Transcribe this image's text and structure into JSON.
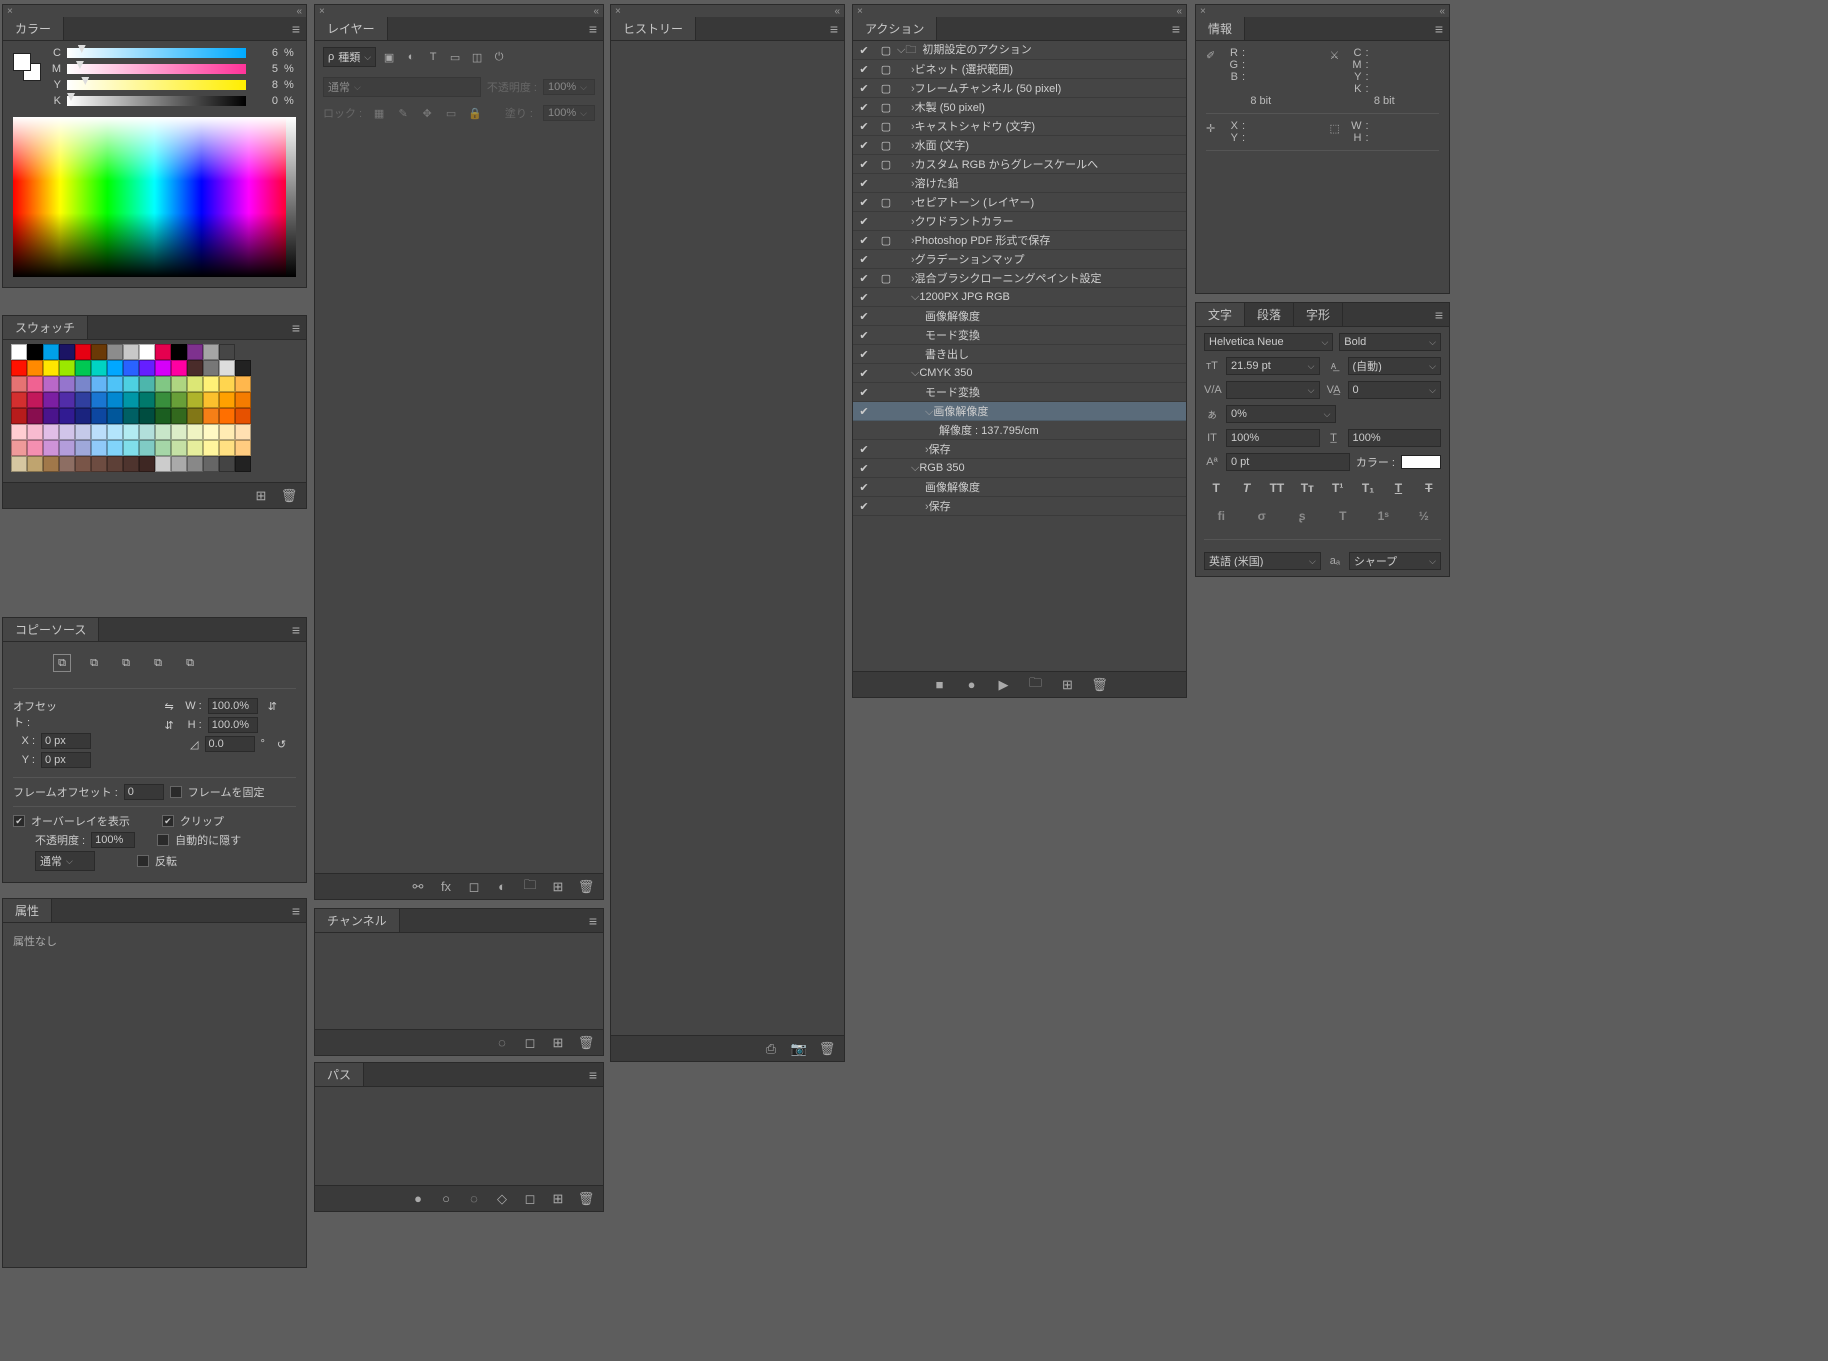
{
  "colorPanel": {
    "tab": "カラー",
    "channels": [
      {
        "label": "C",
        "value": "6",
        "pct": "%",
        "gradient": "linear-gradient(to right,#fff,#00aaff)",
        "pos": 6
      },
      {
        "label": "M",
        "value": "5",
        "pct": "%",
        "gradient": "linear-gradient(to right,#fff,#ff3399)",
        "pos": 5
      },
      {
        "label": "Y",
        "value": "8",
        "pct": "%",
        "gradient": "linear-gradient(to right,#fff,#ffee00)",
        "pos": 8
      },
      {
        "label": "K",
        "value": "0",
        "pct": "%",
        "gradient": "linear-gradient(to right,#fff,#000)",
        "pos": 0
      }
    ]
  },
  "swatchesPanel": {
    "tab": "スウォッチ"
  },
  "copySourcePanel": {
    "tab": "コピーソース",
    "offsetLabel": "オフセット :",
    "xLabel": "X :",
    "yLabel": "Y :",
    "wLabel": "W :",
    "hLabel": "H :",
    "xVal": "0 px",
    "yVal": "0 px",
    "wVal": "100.0%",
    "hVal": "100.0%",
    "angleVal": "0.0",
    "angleSuffix": "°",
    "frameOffsetLabel": "フレームオフセット :",
    "frameOffsetVal": "0",
    "lockFrameLabel": "フレームを固定",
    "showOverlayLabel": "オーバーレイを表示",
    "clipLabel": "クリップ",
    "opacityLabel": "不透明度 :",
    "opacityVal": "100%",
    "autoHideLabel": "自動的に隠す",
    "blendVal": "通常",
    "invertLabel": "反転"
  },
  "propertiesPanel": {
    "tab": "属性",
    "noProps": "属性なし"
  },
  "layersPanel": {
    "tab": "レイヤー",
    "searchPlaceholder": "種類",
    "blendVal": "通常",
    "opacityLabel": "不透明度 :",
    "opacityVal": "100%",
    "lockLabel": "ロック :",
    "fillLabel": "塗り :",
    "fillVal": "100%"
  },
  "channelsPanel": {
    "tab": "チャンネル"
  },
  "pathsPanel": {
    "tab": "パス"
  },
  "historyPanel": {
    "tab": "ヒストリー"
  },
  "actionsPanel": {
    "tab": "アクション",
    "rows": [
      {
        "check": "✔",
        "dlg": "▢",
        "exp": "⌵",
        "indent": 0,
        "folder": true,
        "label": "初期設定のアクション"
      },
      {
        "check": "✔",
        "dlg": "▢",
        "exp": "›",
        "indent": 1,
        "label": "ビネット (選択範囲)"
      },
      {
        "check": "✔",
        "dlg": "▢",
        "exp": "›",
        "indent": 1,
        "label": "フレームチャンネル (50 pixel)"
      },
      {
        "check": "✔",
        "dlg": "▢",
        "exp": "›",
        "indent": 1,
        "label": "木製 (50 pixel)"
      },
      {
        "check": "✔",
        "dlg": "▢",
        "exp": "›",
        "indent": 1,
        "label": "キャストシャドウ (文字)"
      },
      {
        "check": "✔",
        "dlg": "▢",
        "exp": "›",
        "indent": 1,
        "label": "水面 (文字)"
      },
      {
        "check": "✔",
        "dlg": "▢",
        "exp": "›",
        "indent": 1,
        "label": "カスタム RGB からグレースケールへ"
      },
      {
        "check": "✔",
        "dlg": "",
        "exp": "›",
        "indent": 1,
        "label": "溶けた鉛"
      },
      {
        "check": "✔",
        "dlg": "▢",
        "exp": "›",
        "indent": 1,
        "label": "セピアトーン (レイヤー)"
      },
      {
        "check": "✔",
        "dlg": "",
        "exp": "›",
        "indent": 1,
        "label": "クワドラントカラー"
      },
      {
        "check": "✔",
        "dlg": "▢",
        "exp": "›",
        "indent": 1,
        "label": "Photoshop PDF 形式で保存"
      },
      {
        "check": "✔",
        "dlg": "",
        "exp": "›",
        "indent": 1,
        "label": "グラデーションマップ"
      },
      {
        "check": "✔",
        "dlg": "▢",
        "exp": "›",
        "indent": 1,
        "label": "混合ブラシクローニングペイント設定"
      },
      {
        "check": "✔",
        "dlg": "",
        "exp": "⌵",
        "indent": 1,
        "label": "1200PX JPG RGB"
      },
      {
        "check": "✔",
        "dlg": "",
        "exp": "",
        "indent": 2,
        "label": "画像解像度"
      },
      {
        "check": "✔",
        "dlg": "",
        "exp": "",
        "indent": 2,
        "label": "モード変換"
      },
      {
        "check": "✔",
        "dlg": "",
        "exp": "",
        "indent": 2,
        "label": "書き出し"
      },
      {
        "check": "✔",
        "dlg": "",
        "exp": "⌵",
        "indent": 1,
        "label": "CMYK 350"
      },
      {
        "check": "✔",
        "dlg": "",
        "exp": "",
        "indent": 2,
        "label": "モード変換"
      },
      {
        "check": "✔",
        "dlg": "",
        "exp": "⌵",
        "indent": 2,
        "label": "画像解像度",
        "selected": true
      },
      {
        "check": "",
        "dlg": "",
        "exp": "",
        "indent": 3,
        "label": "解像度 : 137.795/cm"
      },
      {
        "check": "✔",
        "dlg": "",
        "exp": "›",
        "indent": 2,
        "label": "保存"
      },
      {
        "check": "✔",
        "dlg": "",
        "exp": "⌵",
        "indent": 1,
        "label": "RGB 350"
      },
      {
        "check": "✔",
        "dlg": "",
        "exp": "",
        "indent": 2,
        "label": "画像解像度"
      },
      {
        "check": "✔",
        "dlg": "",
        "exp": "›",
        "indent": 2,
        "label": "保存"
      }
    ]
  },
  "infoPanel": {
    "tab": "情報",
    "left1": [
      {
        "k": "R",
        "v": ":"
      },
      {
        "k": "G",
        "v": ":"
      },
      {
        "k": "B",
        "v": ":"
      }
    ],
    "right1": [
      {
        "k": "C",
        "v": ":"
      },
      {
        "k": "M",
        "v": ":"
      },
      {
        "k": "Y",
        "v": ":"
      },
      {
        "k": "K",
        "v": ":"
      }
    ],
    "bit": "8 bit",
    "left2": [
      {
        "k": "X",
        "v": ":"
      },
      {
        "k": "Y",
        "v": ":"
      }
    ],
    "right2": [
      {
        "k": "W",
        "v": ":"
      },
      {
        "k": "H",
        "v": ":"
      }
    ]
  },
  "charPanel": {
    "tabs": [
      "文字",
      "段落",
      "字形"
    ],
    "font": "Helvetica Neue",
    "weight": "Bold",
    "size": "21.59 pt",
    "leading": "(自動)",
    "kern": "",
    "tracking": "0",
    "tsume": "0%",
    "vscale": "100%",
    "hscale": "100%",
    "baseline": "0 pt",
    "colorLabel": "カラー :",
    "lang": "英語 (米国)",
    "aa": "シャープ",
    "aaIcon": "aₐ"
  },
  "swatchColors": [
    [
      "#ffffff",
      "#000000",
      "#00a0e9",
      "#1b1464",
      "#e60012",
      "#6a3906",
      "#8c8c8c",
      "#c8c8c8",
      "#ffffff",
      "#e5004f",
      "#000000",
      "#7e318e",
      "#a5a5a5",
      "#464646"
    ],
    [
      "#ff1200",
      "#ff8a00",
      "#ffe600",
      "#9be800",
      "#00c853",
      "#00d3c3",
      "#00a7ff",
      "#2962ff",
      "#651fff",
      "#d500f9",
      "#ff00a1",
      "#4a2c2a",
      "#777",
      "#ddd",
      "#222"
    ],
    [
      "#e57373",
      "#f06292",
      "#ba68c8",
      "#9575cd",
      "#7986cb",
      "#64b5f6",
      "#4fc3f7",
      "#4dd0e1",
      "#4db6ac",
      "#81c784",
      "#aed581",
      "#dce775",
      "#fff176",
      "#ffd54f",
      "#ffb74d"
    ],
    [
      "#d32f2f",
      "#c2185b",
      "#7b1fa2",
      "#512da8",
      "#303f9f",
      "#1976d2",
      "#0288d1",
      "#0097a7",
      "#00796b",
      "#388e3c",
      "#689f38",
      "#afb42b",
      "#fbc02d",
      "#ffa000",
      "#f57c00"
    ],
    [
      "#b71c1c",
      "#880e4f",
      "#4a148c",
      "#311b92",
      "#1a237e",
      "#0d47a1",
      "#01579b",
      "#006064",
      "#004d40",
      "#1b5e20",
      "#33691e",
      "#827717",
      "#f57f17",
      "#ff6f00",
      "#e65100"
    ],
    [
      "#ffcdd2",
      "#f8bbd0",
      "#e1bee7",
      "#d1c4e9",
      "#c5cae9",
      "#bbdefb",
      "#b3e5fc",
      "#b2ebf2",
      "#b2dfdb",
      "#c8e6c9",
      "#dcedc8",
      "#f0f4c3",
      "#fff9c4",
      "#ffecb3",
      "#ffe0b2"
    ],
    [
      "#ef9a9a",
      "#f48fb1",
      "#ce93d8",
      "#b39ddb",
      "#9fa8da",
      "#90caf9",
      "#81d4fa",
      "#80deea",
      "#80cbc4",
      "#a5d6a7",
      "#c5e1a5",
      "#e6ee9c",
      "#fff59d",
      "#ffe082",
      "#ffcc80"
    ],
    [
      "#d6c7a1",
      "#bfa46f",
      "#a1784a",
      "#8d6e63",
      "#795548",
      "#6d4c41",
      "#5d4037",
      "#4e342e",
      "#3e2723",
      "#ccc",
      "#aaa",
      "#888",
      "#666",
      "#444",
      "#222"
    ]
  ]
}
